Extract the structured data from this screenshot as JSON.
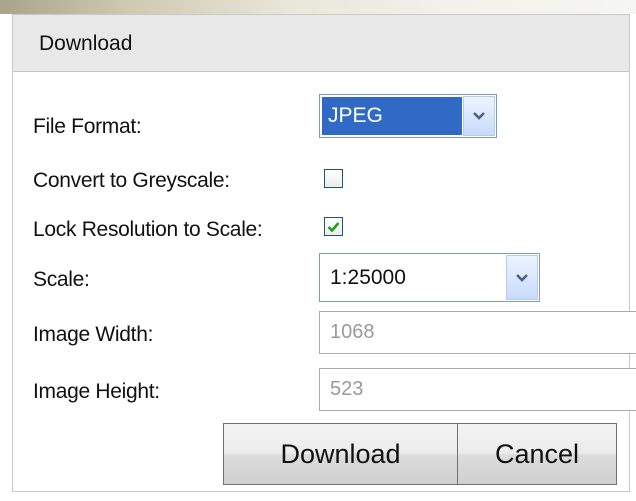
{
  "dialog": {
    "title": "Download",
    "file_format": {
      "label": "File Format:",
      "value": "JPEG"
    },
    "greyscale": {
      "label": "Convert to Greyscale:",
      "checked": false
    },
    "lock_resolution": {
      "label": "Lock Resolution to Scale:",
      "checked": true
    },
    "scale": {
      "label": "Scale:",
      "value": "1:25000"
    },
    "image_width": {
      "label": "Image Width:",
      "value": "1068"
    },
    "image_height": {
      "label": "Image Height:",
      "value": "523"
    },
    "download_label": "Download",
    "cancel_label": "Cancel"
  },
  "icons": {
    "dropdown": "chevron-down-icon",
    "check": "checkmark-icon"
  },
  "colors": {
    "selection": "#316ac5",
    "check": "#21a121",
    "disabled_text": "#9a9a9a",
    "titlebar": "#e8e8e8"
  }
}
